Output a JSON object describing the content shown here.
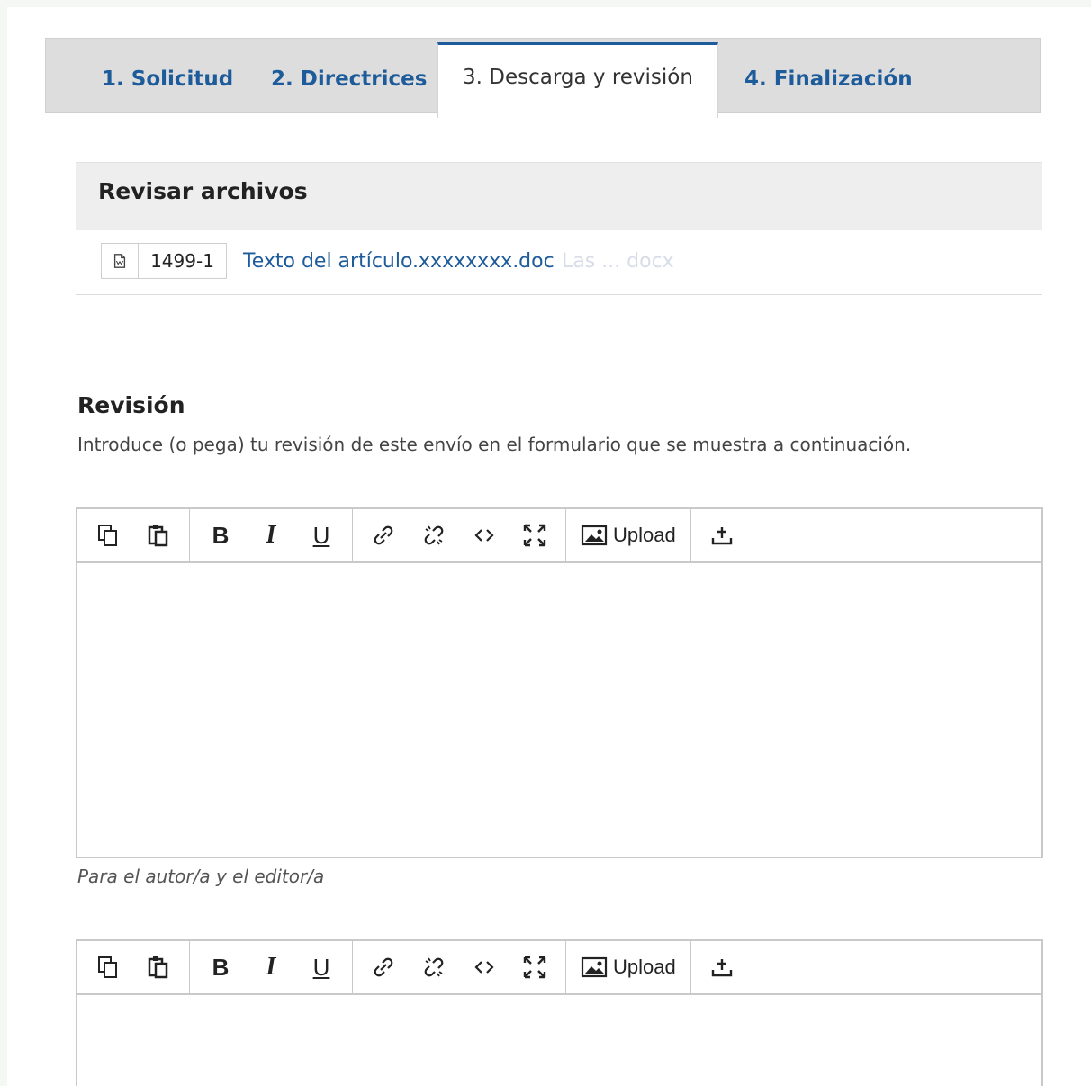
{
  "tabs": [
    {
      "label": "1. Solicitud"
    },
    {
      "label": "2. Directrices"
    },
    {
      "label": "3. Descarga y revisión"
    },
    {
      "label": "4. Finalización"
    }
  ],
  "files": {
    "title": "Revisar archivos",
    "items": [
      {
        "id": "1499-1",
        "name": "Texto del artículo.xxxxxxxx.doc",
        "faded_suffix": "Las ... docx",
        "icon": "document-icon"
      }
    ]
  },
  "review": {
    "title": "Revisión",
    "description": "Introduce (o pega) tu revisión de este envío en el formulario que se muestra a continuación.",
    "editor_note": "Para el autor/a y el editor/a"
  },
  "toolbar": {
    "upload_label": "Upload",
    "bold": "B",
    "italic": "I",
    "underline": "U"
  },
  "colors": {
    "accent": "#1d5b9a",
    "tab_bg": "#dddddd"
  }
}
